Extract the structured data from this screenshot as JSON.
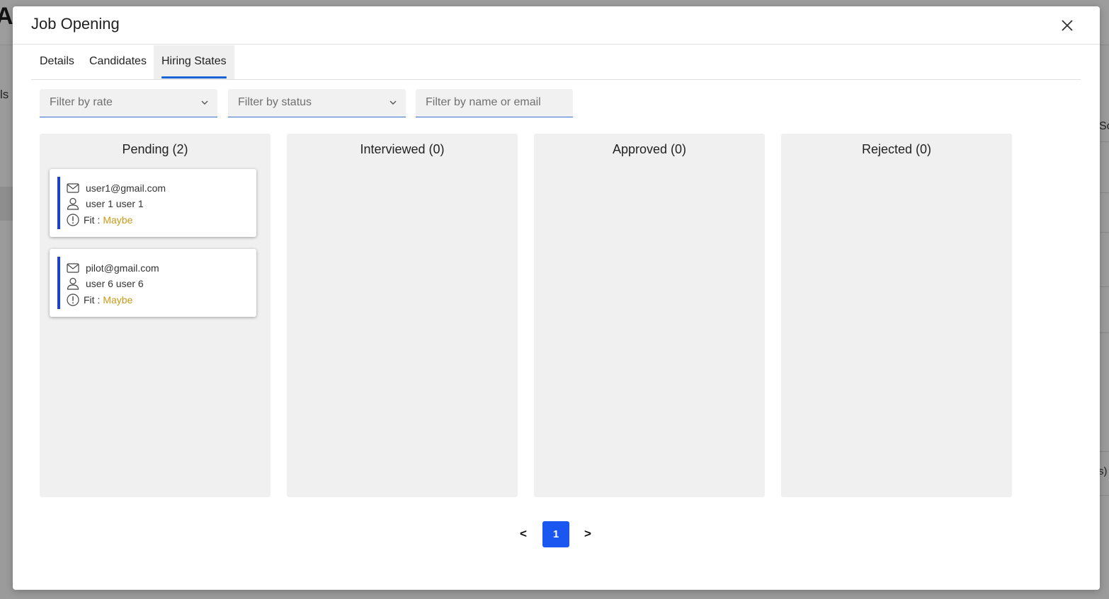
{
  "background": {
    "app_letter": "A",
    "side_text": "ls",
    "right_text": "Sc",
    "right_text_2": "s)"
  },
  "modal": {
    "title": "Job Opening",
    "close_icon": "close-icon"
  },
  "tabs": [
    {
      "label": "Details",
      "active": false
    },
    {
      "label": "Candidates",
      "active": false
    },
    {
      "label": "Hiring States",
      "active": true
    }
  ],
  "filters": {
    "rate_placeholder": "Filter by rate",
    "status_placeholder": "Filter by status",
    "search_placeholder": "Filter by name or email"
  },
  "columns": [
    {
      "title": "Pending (2)",
      "cards": [
        {
          "email": "user1@gmail.com",
          "name": "user 1 user 1",
          "fit_label": "Fit :",
          "fit_value": "Maybe"
        },
        {
          "email": "pilot@gmail.com",
          "name": "user 6 user 6",
          "fit_label": "Fit :",
          "fit_value": "Maybe"
        }
      ]
    },
    {
      "title": "Interviewed (0)",
      "cards": []
    },
    {
      "title": "Approved (0)",
      "cards": []
    },
    {
      "title": "Rejected (0)",
      "cards": []
    }
  ],
  "pagination": {
    "prev": "<",
    "current": "1",
    "next": ">"
  },
  "colors": {
    "accent": "#1a56f0",
    "card_bar": "#1a3fe0",
    "fit_maybe": "#c99a18",
    "tab_underline": "#1a63d6"
  }
}
